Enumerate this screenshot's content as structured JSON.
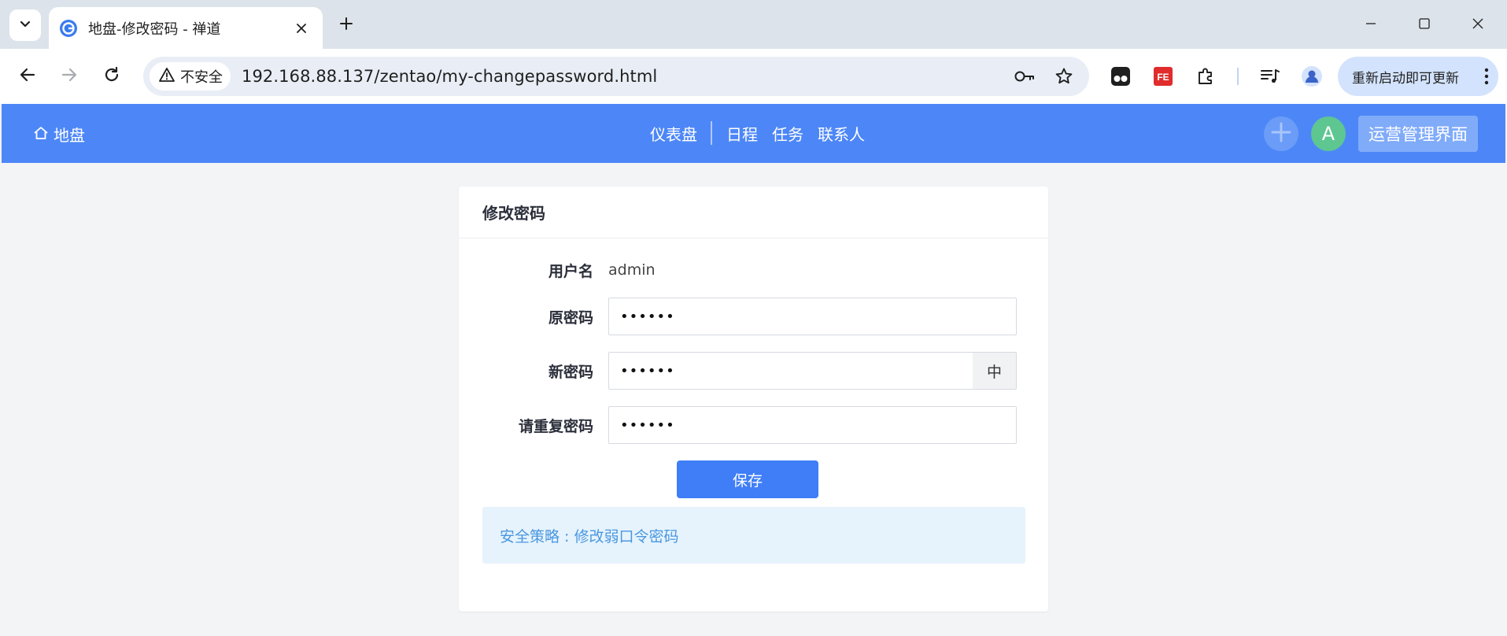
{
  "browser": {
    "tab": {
      "title": "地盘-修改密码 - 禅道"
    },
    "security_label": "不安全",
    "url": "192.168.88.137/zentao/my-changepassword.html",
    "update_button": "重新启动即可更新"
  },
  "header": {
    "home": "地盘",
    "nav": [
      {
        "label": "仪表盘"
      },
      {
        "label": "日程"
      },
      {
        "label": "任务"
      },
      {
        "label": "联系人"
      }
    ],
    "avatar_initial": "A",
    "ops_button": "运营管理界面",
    "brand_color": "#4d87f7"
  },
  "card": {
    "title": "修改密码",
    "username_label": "用户名",
    "username_value": "admin",
    "old_password_label": "原密码",
    "old_password_value": "••••••",
    "new_password_label": "新密码",
    "new_password_value": "••••••",
    "strength_label": "中",
    "repeat_password_label": "请重复密码",
    "repeat_password_value": "••••••",
    "save_button": "保存",
    "policy_text": "安全策略 : 修改弱口令密码"
  }
}
